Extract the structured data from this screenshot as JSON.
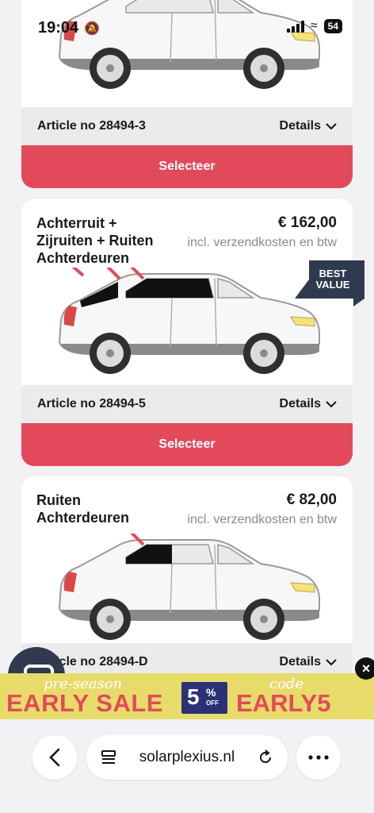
{
  "status": {
    "time": "19:04",
    "battery": "54",
    "icons": [
      "bell-off-icon",
      "cellular-signal-icon",
      "wifi-icon",
      "battery-icon"
    ]
  },
  "cards": [
    {
      "article": "Article no 28494-3",
      "details": "Details",
      "select": "Selecteer"
    },
    {
      "title_lines": [
        "Achterruit +",
        "Zijruiten + Ruiten",
        "Achterdeuren"
      ],
      "price": "€ 162,00",
      "note": "incl. verzendkosten en btw",
      "badge_lines": [
        "BEST",
        "VALUE"
      ],
      "article": "Article no 28494-5",
      "details": "Details",
      "select": "Selecteer"
    },
    {
      "title_lines": [
        "Ruiten",
        "Achterdeuren"
      ],
      "price": "€ 82,00",
      "note": "incl. verzendkosten en btw",
      "article": "Article no 28494-D",
      "details": "Details"
    }
  ],
  "promo": {
    "pre_label": "pre-season",
    "sale_label": "EARLY SALE",
    "discount_number": "5",
    "discount_percent": "%",
    "discount_off": "OFF",
    "code_label": "code",
    "code": "EARLY5",
    "close": "×"
  },
  "browser": {
    "url": "solarplexius.nl",
    "icons": [
      "back-icon",
      "page-icon",
      "reload-icon",
      "more-icon"
    ]
  },
  "colors": {
    "accent": "#e24a5c",
    "badge": "#2f3a4f",
    "promo_bg": "#e7db6a",
    "promo_box": "#2a3177"
  }
}
